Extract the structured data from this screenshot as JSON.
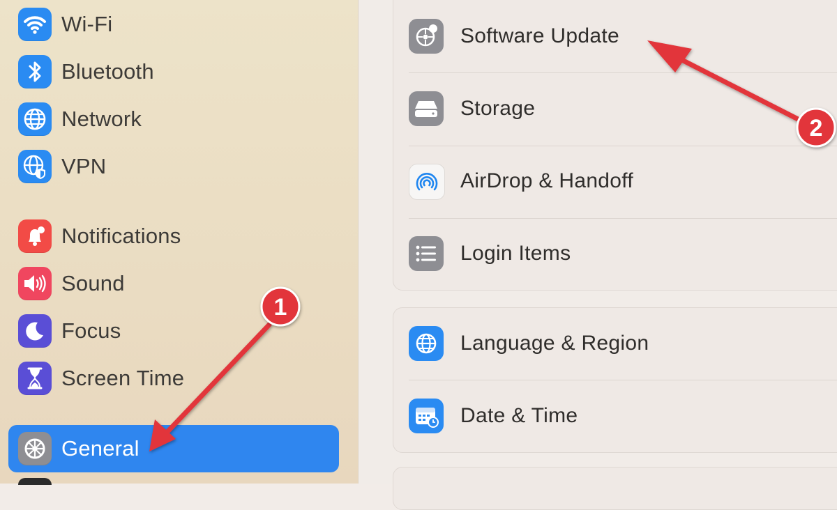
{
  "sidebar": {
    "items": [
      {
        "label": "Wi-Fi",
        "icon": "wifi-icon",
        "color": "#2a8bf2"
      },
      {
        "label": "Bluetooth",
        "icon": "bluetooth-icon",
        "color": "#2a8bf2"
      },
      {
        "label": "Network",
        "icon": "globe-icon",
        "color": "#2a8bf2"
      },
      {
        "label": "VPN",
        "icon": "vpn-globe-shield-icon",
        "color": "#2a8bf2"
      },
      {
        "label": "Notifications",
        "icon": "bell-icon",
        "color": "#f24b46"
      },
      {
        "label": "Sound",
        "icon": "speaker-icon",
        "color": "#f0465f"
      },
      {
        "label": "Focus",
        "icon": "moon-icon",
        "color": "#5a4ed6"
      },
      {
        "label": "Screen Time",
        "icon": "hourglass-icon",
        "color": "#5a4ed6"
      },
      {
        "label": "General",
        "icon": "gear-icon",
        "color": "#8e8e93",
        "selected": true
      }
    ],
    "selected_color": "#2f86ef"
  },
  "main": {
    "group1": [
      {
        "label": "Software Update",
        "icon": "gear-badge-icon"
      },
      {
        "label": "Storage",
        "icon": "drive-icon"
      },
      {
        "label": "AirDrop & Handoff",
        "icon": "airdrop-icon"
      },
      {
        "label": "Login Items",
        "icon": "list-icon"
      }
    ],
    "group2": [
      {
        "label": "Language & Region",
        "icon": "globe-icon"
      },
      {
        "label": "Date & Time",
        "icon": "calendar-clock-icon"
      }
    ]
  },
  "annotations": {
    "step1": "1",
    "step2": "2",
    "arrow_color": "#e2353a"
  }
}
